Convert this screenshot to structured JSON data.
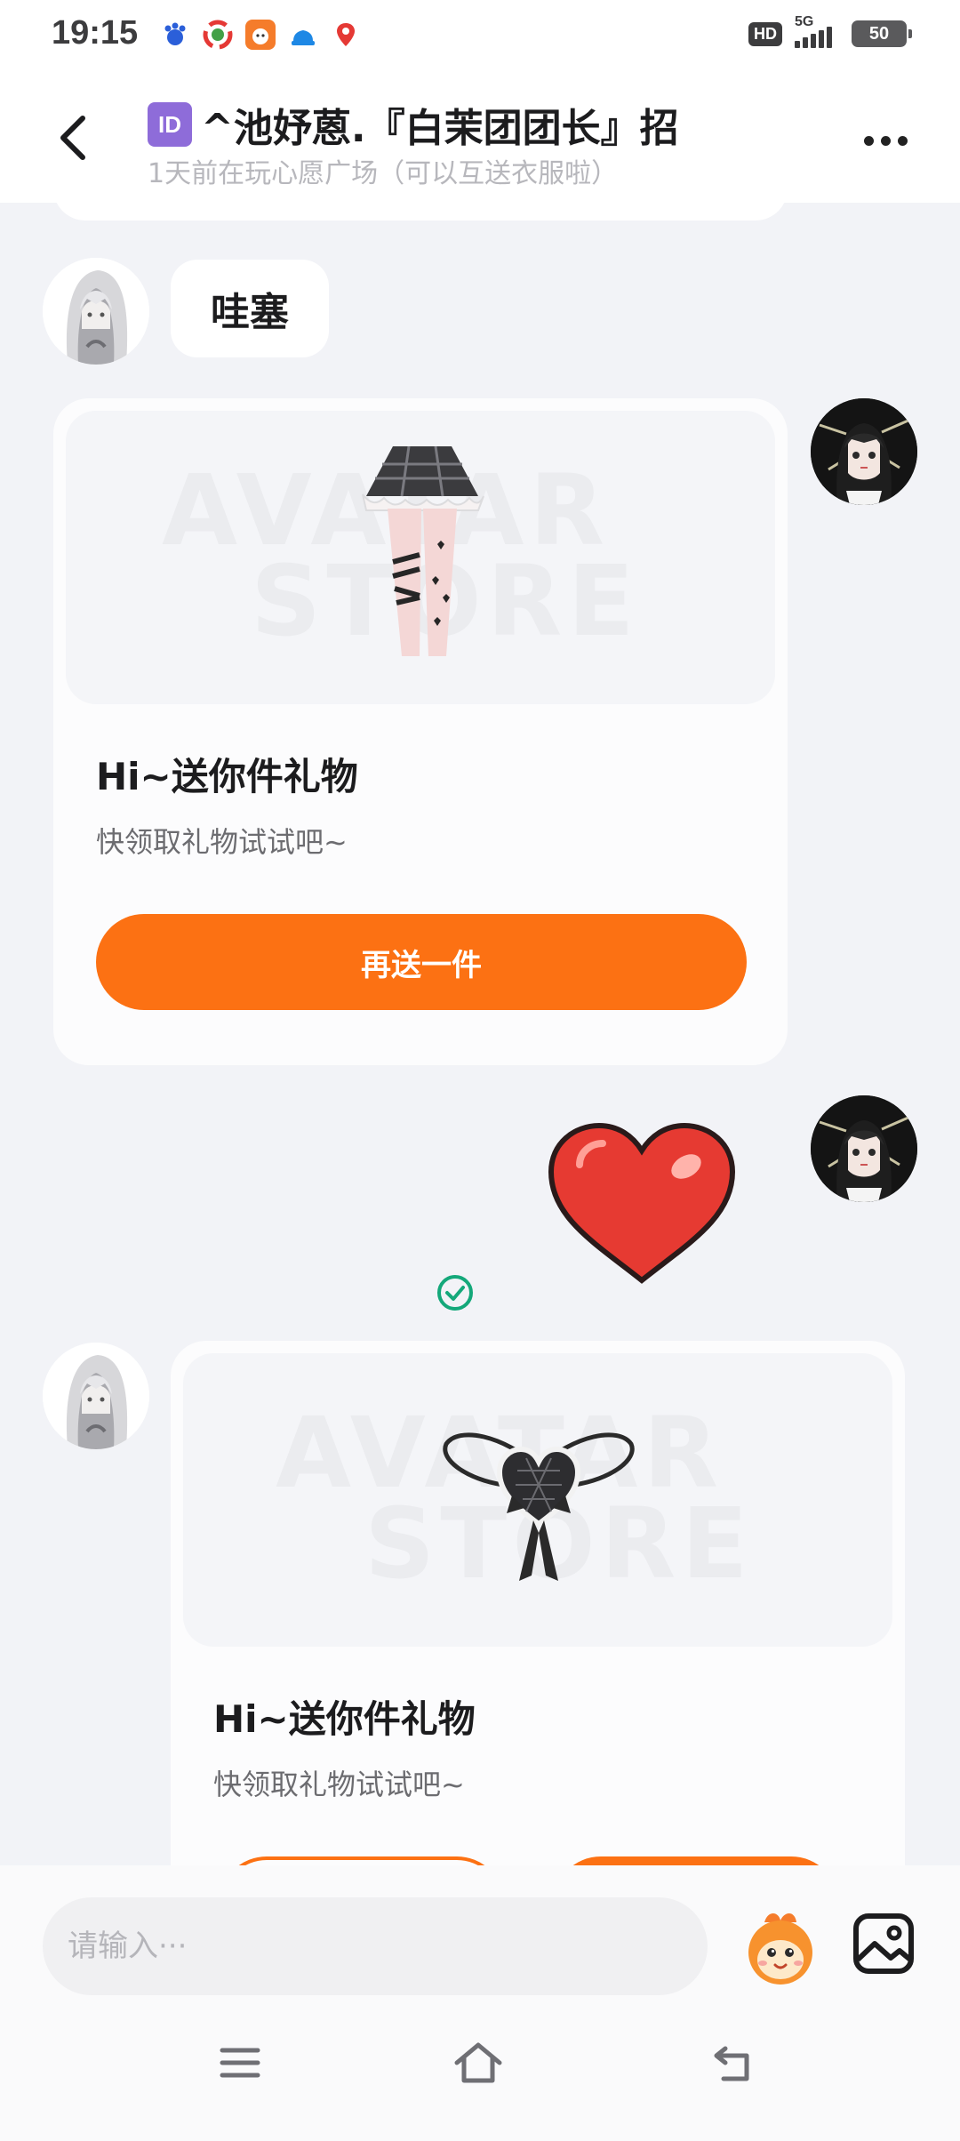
{
  "status_bar": {
    "time": "19:15",
    "hd": "HD",
    "network": "5G",
    "battery": "50"
  },
  "header": {
    "id_badge": "ID",
    "title": "^池妤蒽.『白茉团团长』招",
    "subtitle": "1天前在玩心愿广场（可以互送衣服啦）"
  },
  "messages": {
    "bubble_text": "哇塞",
    "gift_card_1": {
      "title": "Hi~送你件礼物",
      "desc": "快领取礼物试试吧~",
      "button": "再送一件",
      "watermark_top": "AVATAR",
      "watermark_bottom": "STORE"
    },
    "gift_card_2": {
      "title": "Hi~送你件礼物",
      "desc": "快领取礼物试试吧~",
      "watermark_top": "AVATAR",
      "watermark_bottom": "STORE"
    }
  },
  "input_bar": {
    "placeholder": "请输入···"
  },
  "icons": {
    "back": "chevron-left-icon",
    "more": "more-dots-icon",
    "read": "check-circle-icon",
    "mascot": "mascot-emoji-icon",
    "image": "image-icon",
    "nav_menu": "menu-icon",
    "nav_home": "home-icon",
    "nav_back": "back-icon"
  },
  "colors": {
    "accent": "#fc7113",
    "read_check": "#14a87a",
    "background": "#f2f3f7"
  }
}
